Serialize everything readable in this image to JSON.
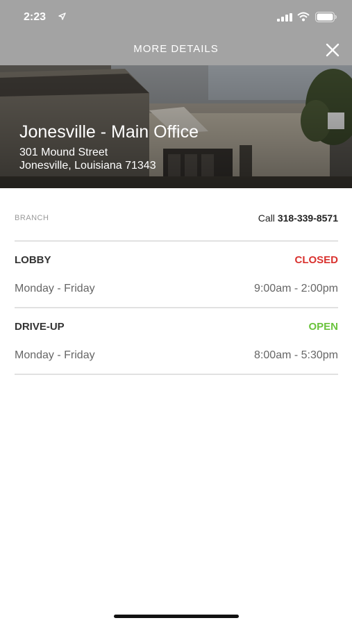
{
  "status_bar": {
    "time": "2:23"
  },
  "nav": {
    "title": "MORE DETAILS"
  },
  "office": {
    "name": "Jonesville - Main Office",
    "street": "301 Mound Street",
    "city_state_zip": "Jonesville, Louisiana 71343"
  },
  "branch": {
    "label": "BRANCH",
    "call_prefix": "Call",
    "phone": "318-339-8571"
  },
  "hours": [
    {
      "name": "LOBBY",
      "status": "CLOSED",
      "status_color": "#d9322f",
      "days": "Monday - Friday",
      "time": "9:00am - 2:00pm"
    },
    {
      "name": "DRIVE-UP",
      "status": "OPEN",
      "status_color": "#6ac33c",
      "days": "Monday - Friday",
      "time": "8:00am - 5:30pm"
    }
  ]
}
